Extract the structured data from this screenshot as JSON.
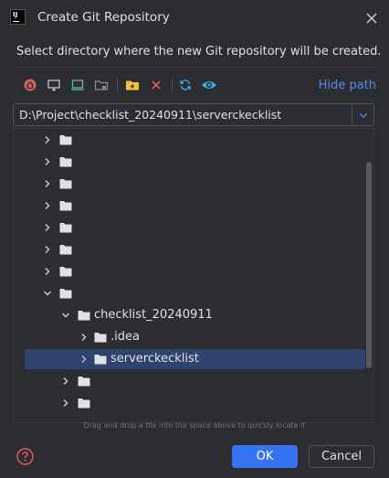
{
  "dialog": {
    "app_logo_text": "IJ",
    "title": "Create Git Repository",
    "subtitle": "Select directory where the new Git repository will be created."
  },
  "toolbar": {
    "icons": [
      "home-icon",
      "desktop-icon",
      "project-icon",
      "module-icon",
      "new-folder-icon",
      "delete-icon",
      "refresh-icon",
      "show-hidden-icon"
    ],
    "hide_path_label": "Hide path"
  },
  "path": {
    "value": "D:\\Project\\checklist_20240911\\serverckecklist"
  },
  "tree": {
    "rows": [
      {
        "label": "",
        "expanded": false
      },
      {
        "label": "",
        "expanded": false
      },
      {
        "label": "",
        "expanded": false
      },
      {
        "label": "",
        "expanded": false
      },
      {
        "label": "",
        "expanded": false
      },
      {
        "label": "",
        "expanded": false
      },
      {
        "label": "",
        "expanded": false
      },
      {
        "label": "",
        "expanded": true
      },
      {
        "label": "checklist_20240911",
        "expanded": true
      },
      {
        "label": ".idea",
        "expanded": false
      },
      {
        "label": "serverckecklist",
        "expanded": false,
        "selected": true
      },
      {
        "label": "",
        "expanded": false
      },
      {
        "label": "",
        "expanded": false
      }
    ],
    "hint": "Drag and drop a file into the space above to quickly locate it"
  },
  "footer": {
    "ok_label": "OK",
    "cancel_label": "Cancel"
  },
  "colors": {
    "background": "#2b2d30",
    "accent": "#3574f0",
    "selection": "#2e436e",
    "link": "#548af7"
  }
}
